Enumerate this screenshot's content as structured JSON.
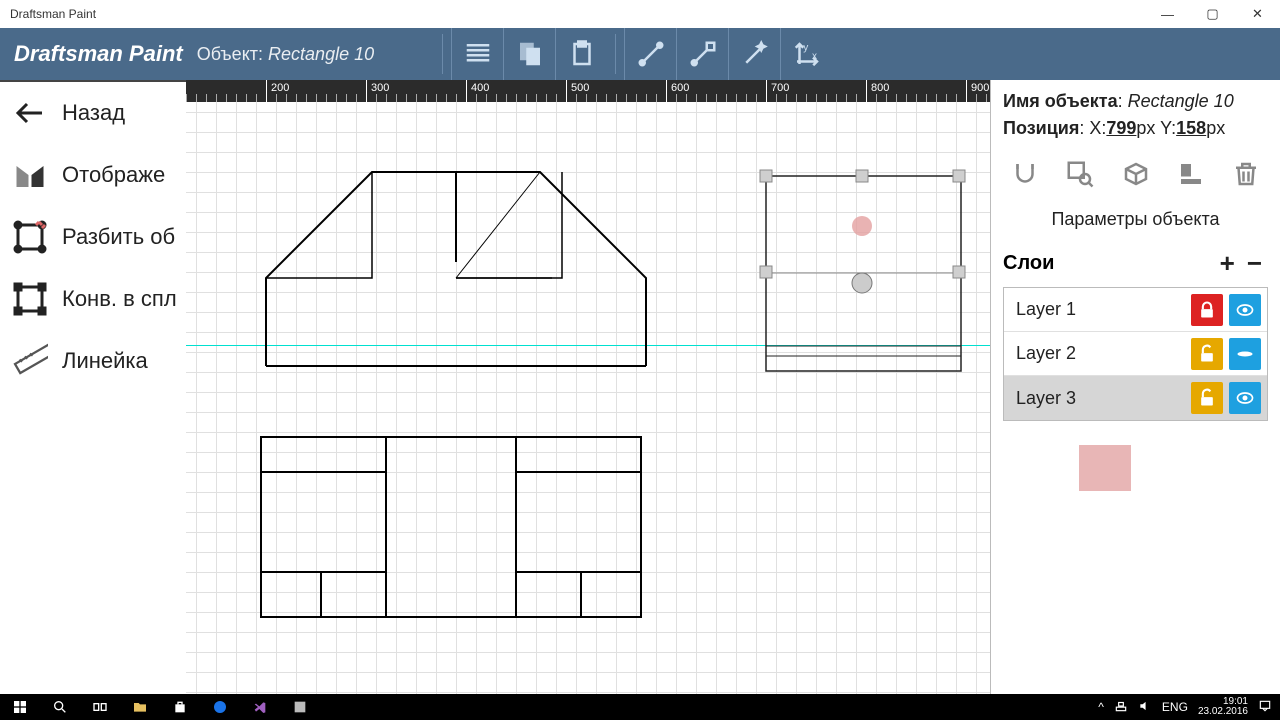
{
  "window": {
    "title": "Draftsman Paint"
  },
  "toolbar": {
    "app_title": "Draftsman Paint",
    "object_label": "Объект:",
    "object_name": "Rectangle 10"
  },
  "leftbar": {
    "back": "Назад",
    "display": "Отображе",
    "break": "Разбить об",
    "convert": "Конв. в спл",
    "ruler": "Линейка"
  },
  "ruler_ticks": [
    "200",
    "300",
    "400",
    "500",
    "600",
    "700",
    "800",
    "900"
  ],
  "rightpanel": {
    "name_label": "Имя объекта",
    "name_value": "Rectangle 10",
    "pos_label": "Позиция",
    "pos_x_label": "X:",
    "pos_x_value": "799",
    "pos_y_label": "Y:",
    "pos_y_value": "158",
    "px": "px",
    "params_title": "Параметры объекта",
    "layers_title": "Слои",
    "layers": [
      {
        "name": "Layer 1",
        "locked": true,
        "visible": true,
        "selected": false
      },
      {
        "name": "Layer 2",
        "locked": false,
        "visible_alt": true,
        "selected": false
      },
      {
        "name": "Layer 3",
        "locked": false,
        "visible": true,
        "selected": true
      }
    ]
  },
  "taskbar": {
    "tray_net": "^",
    "tray_lang": "ENG",
    "time": "19:01",
    "date": "23.02.2016"
  }
}
